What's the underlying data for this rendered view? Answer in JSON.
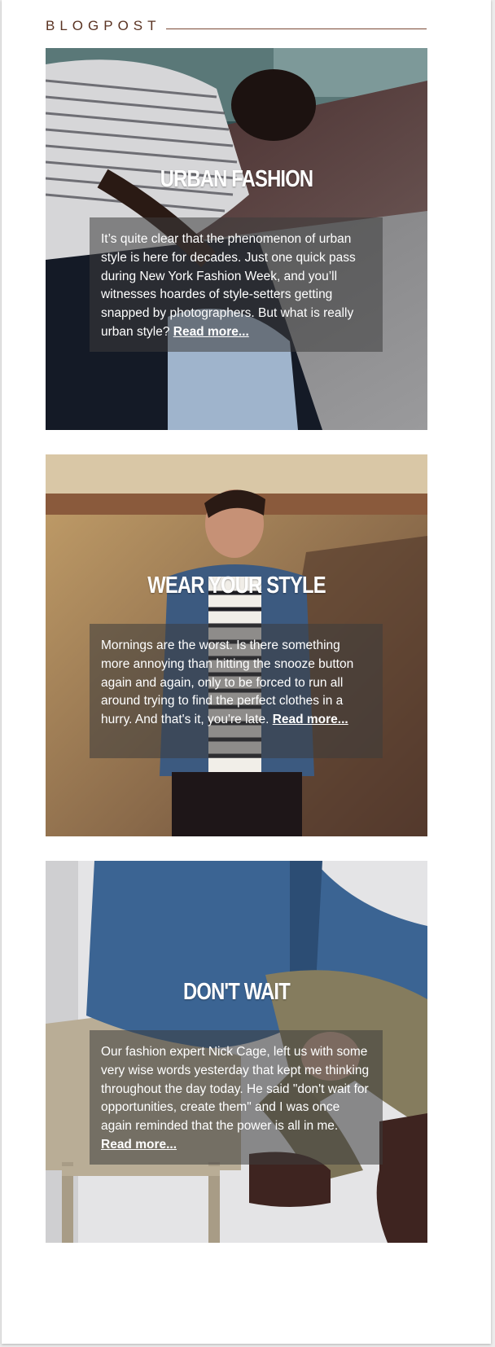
{
  "header": {
    "label": "BLOGPOST"
  },
  "posts": [
    {
      "title": "URBAN FASHION",
      "body": "It’s quite clear that the phenomenon of urban style is here for decades. Just one quick pass during New York Fashion Week, and you’ll witnesses hoardes of style-setters getting snapped by photographers. But what is really urban style?",
      "link": "Read more...",
      "image": "man-in-striped-tshirt-photo"
    },
    {
      "title": "WEAR YOUR STYLE",
      "body": "Mornings are the worst. Is there something more annoying than hitting the snooze button again and again, only to be forced to run all around trying to find the perfect clothes in a hurry. And that's it, you're late.",
      "link": "Read more...",
      "image": "man-in-denim-shirt-photo"
    },
    {
      "title": "DON'T WAIT",
      "body": "Our fashion expert Nick Cage, left us with some very wise words yesterday that kept me thinking throughout the day today. He said \"don't wait for opportunities, create them\" and I was once again reminded that the power is all in me.",
      "link": "Read more...",
      "image": "seated-man-in-denim-photo"
    }
  ],
  "colors": {
    "header_text": "#5a3322",
    "header_rule": "#7a4a36",
    "overlay": "rgba(60,60,60,0.55)",
    "text": "#ffffff"
  }
}
